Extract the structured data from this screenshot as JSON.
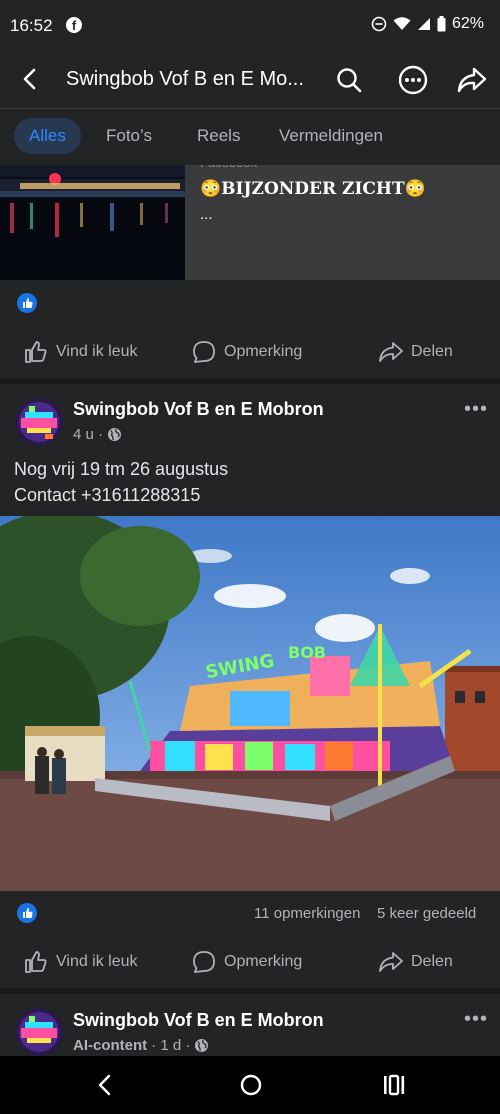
{
  "status": {
    "time": "16:52",
    "battery": "62%"
  },
  "header": {
    "title": "Swingbob Vof B en E Mo..."
  },
  "tabs": [
    {
      "label": "Alles",
      "active": true
    },
    {
      "label": "Foto’s",
      "active": false
    },
    {
      "label": "Reels",
      "active": false
    },
    {
      "label": "Vermeldingen",
      "active": false
    }
  ],
  "post1": {
    "link_source": "Facebook",
    "link_title": "😳BIJZONDER ZICHT😳",
    "link_ellipsis": "...",
    "actions": {
      "like": "Vind ik leuk",
      "comment": "Opmerking",
      "share": "Delen"
    }
  },
  "post2": {
    "author": "Swingbob Vof B en E Mobron",
    "time": "4 u ·",
    "text_line1": "Nog vrij 19 tm 26 augustus",
    "text_line2": "Contact +31611288315",
    "photo_sign_1": "SWING",
    "photo_sign_2": "BOB",
    "comments": "11 opmerkingen",
    "shares": "5 keer gedeeld",
    "actions": {
      "like": "Vind ik leuk",
      "comment": "Opmerking",
      "share": "Delen"
    }
  },
  "post3": {
    "author": "Swingbob Vof B en E Mobron",
    "label": "AI-content",
    "time": "· 1 d ·"
  },
  "colors": {
    "accent": "#2d88ff",
    "bg": "#232426",
    "like_blue": "#1b74e4"
  }
}
